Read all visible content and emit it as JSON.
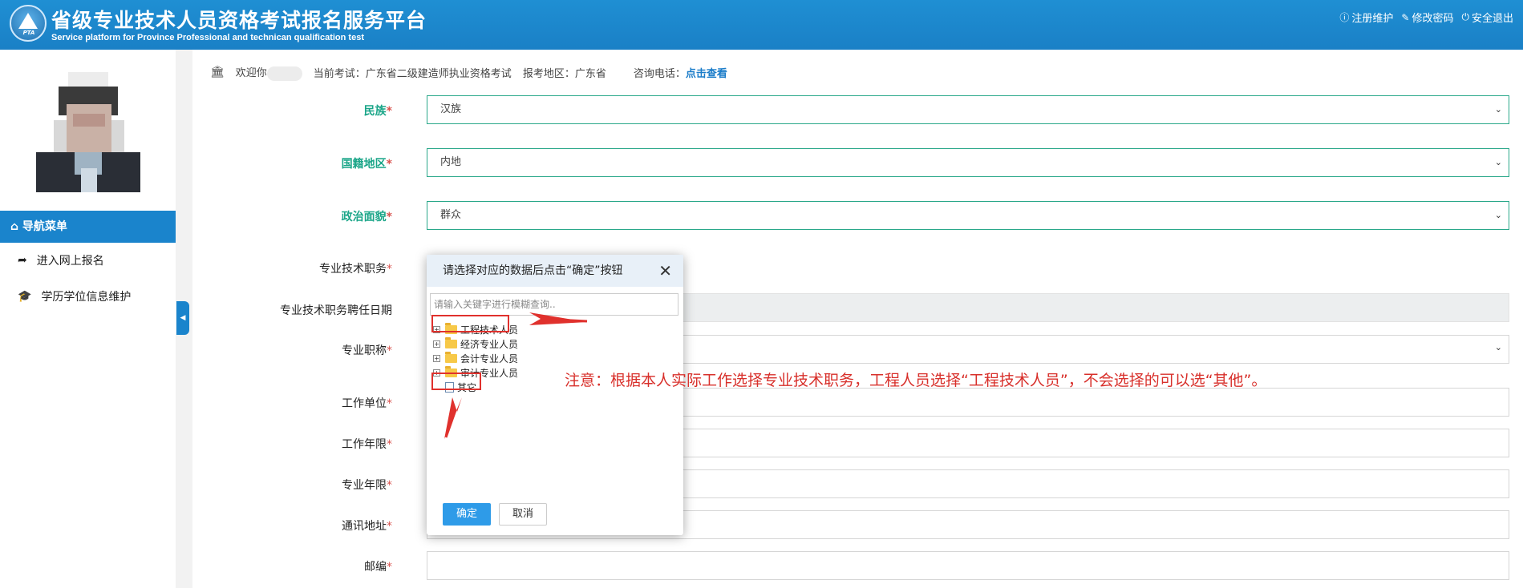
{
  "header": {
    "title_cn": "省级专业技术人员资格考试报名服务平台",
    "title_en": "Service platform for Province Professional and technican qualification test",
    "logo_text": "PTA",
    "links": [
      {
        "icon": "info-icon",
        "label": "注册维护"
      },
      {
        "icon": "edit-icon",
        "label": "修改密码"
      },
      {
        "icon": "power-icon",
        "label": "安全退出"
      }
    ]
  },
  "sidebar": {
    "nav_header": "导航菜单",
    "items": [
      {
        "icon": "share-arrow-icon",
        "label": "进入网上报名"
      },
      {
        "icon": "graduation-cap-icon",
        "label": "学历学位信息维护"
      }
    ]
  },
  "infobar": {
    "welcome": "欢迎你",
    "exam": "当前考试：广东省二级建造师执业资格考试",
    "region": "报考地区：广东省",
    "phone_label": "咨询电话：",
    "phone_link": "点击查看"
  },
  "form": {
    "fields": [
      {
        "label": "民族",
        "value": "汉族"
      },
      {
        "label": "国籍地区",
        "value": "内地"
      },
      {
        "label": "政治面貌",
        "value": "群众"
      },
      {
        "label": "专业技术职务"
      },
      {
        "label": "专业技术职务聘任日期"
      },
      {
        "label": "专业职称"
      },
      {
        "label": "工作单位"
      },
      {
        "label": "工作年限"
      },
      {
        "label": "专业年限"
      },
      {
        "label": "通讯地址"
      },
      {
        "label": "邮编"
      }
    ]
  },
  "modal": {
    "title": "请选择对应的数据后点击“确定”按钮",
    "search_placeholder": "请输入关键字进行模糊查询..",
    "tree": [
      "工程技术人员",
      "经济专业人员",
      "会计专业人员",
      "审计专业人员",
      "其它"
    ],
    "ok": "确定",
    "cancel": "取消"
  },
  "annotation": "注意：根据本人实际工作选择专业技术职务，工程人员选择“工程技术人员”，不会选择的可以选“其他”。",
  "colors": {
    "header": "#1a84cc",
    "accent_green": "#1aa588",
    "annotation_red": "#d8302b"
  }
}
